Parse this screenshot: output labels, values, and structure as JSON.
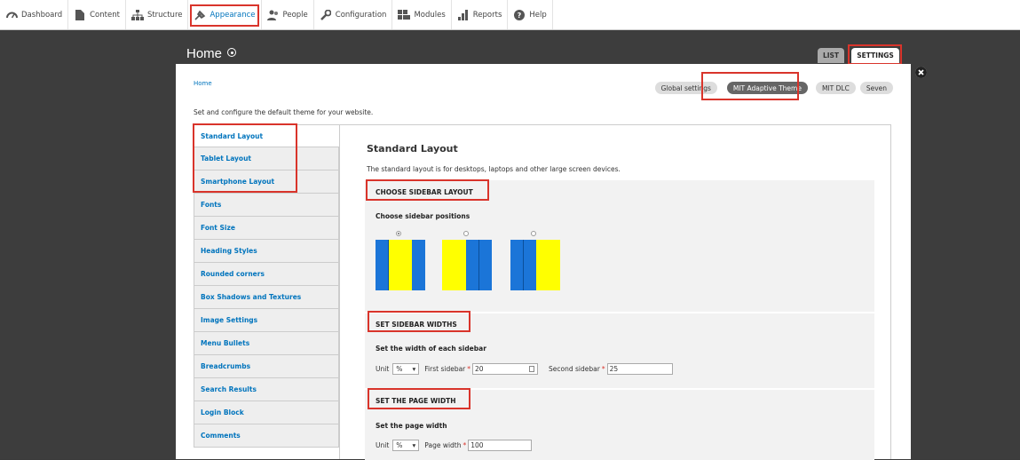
{
  "toolbar": {
    "items": [
      {
        "label": "Dashboard",
        "icon": "dashboard-icon"
      },
      {
        "label": "Content",
        "icon": "content-icon"
      },
      {
        "label": "Structure",
        "icon": "structure-icon"
      },
      {
        "label": "Appearance",
        "icon": "appearance-icon"
      },
      {
        "label": "People",
        "icon": "people-icon"
      },
      {
        "label": "Configuration",
        "icon": "configuration-icon"
      },
      {
        "label": "Modules",
        "icon": "modules-icon"
      },
      {
        "label": "Reports",
        "icon": "reports-icon"
      },
      {
        "label": "Help",
        "icon": "help-icon"
      }
    ]
  },
  "modal": {
    "title": "Home",
    "tabs": {
      "list": "LIST",
      "settings": "SETTINGS"
    },
    "breadcrumb": "Home",
    "theme_pills": [
      "Global settings",
      "MIT Adaptive Theme",
      "MIT DLC",
      "Seven"
    ],
    "description": "Set and configure the default theme for your website."
  },
  "vertical_tabs": [
    "Standard Layout",
    "Tablet Layout",
    "Smartphone Layout",
    "Fonts",
    "Font Size",
    "Heading Styles",
    "Rounded corners",
    "Box Shadows and Textures",
    "Image Settings",
    "Menu Bullets",
    "Breadcrumbs",
    "Search Results",
    "Login Block",
    "Comments"
  ],
  "content": {
    "title": "Standard Layout",
    "description": "The standard layout is for desktops, laptops and other large screen devices.",
    "sidebar_layout": {
      "legend": "CHOOSE SIDEBAR LAYOUT",
      "label": "Choose sidebar positions",
      "selected_index": 0
    },
    "sidebar_widths": {
      "legend": "SET SIDEBAR WIDTHS",
      "label": "Set the width of each sidebar",
      "unit_label": "Unit",
      "unit_value": "%",
      "first_label": "First sidebar",
      "first_value": "20",
      "second_label": "Second sidebar",
      "second_value": "25",
      "required_mark": "*"
    },
    "page_width": {
      "legend": "SET THE PAGE WIDTH",
      "label": "Set the page width",
      "unit_label": "Unit",
      "unit_value": "%",
      "width_label": "Page width",
      "width_value": "100",
      "required_mark": "*"
    }
  },
  "colors": {
    "accent_red": "#d9342b",
    "link_blue": "#0074bd",
    "layout_blue": "#1b75d8",
    "layout_yellow": "#ffff00"
  }
}
